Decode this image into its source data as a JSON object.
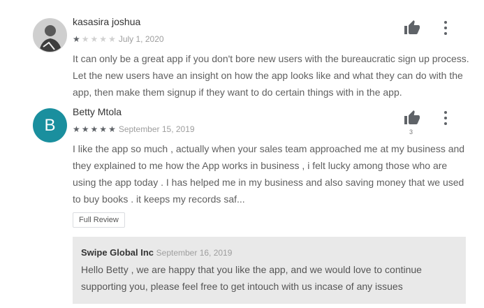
{
  "reviews": [
    {
      "author": "kasasira joshua",
      "rating": 1,
      "max_rating": 5,
      "date": "July 1, 2020",
      "text": "It can only be a great app if you don't bore new users with the bureaucratic sign up process. Let the new users have an insight on how the app looks like and what they can do with the app, then make them signup if they want to do certain things with in the app.",
      "helpful_count": ""
    },
    {
      "author": "Betty Mtola",
      "avatar_letter": "B",
      "rating": 5,
      "max_rating": 5,
      "date": "September 15, 2019",
      "text": "I like the app so much , actually when your sales team approached me at my business and they explained to me how the App works in business , i felt lucky among those who are using the app today . I has helped me in my business and also saving money that we used to buy books . it keeps my records saf...",
      "helpful_count": "3",
      "full_review_label": "Full Review",
      "reply": {
        "author": "Swipe Global Inc",
        "date": "September 16, 2019",
        "text": "Hello Betty , we are happy that you like the app, and we would love to continue supporting you, please feel free to get intouch with us incase of any issues"
      }
    }
  ],
  "colors": {
    "avatar_bg": "#1a8f9e",
    "reply_bg": "#e9e9e9",
    "star_on": "#5f6368",
    "star_off": "#d0d0d0"
  }
}
